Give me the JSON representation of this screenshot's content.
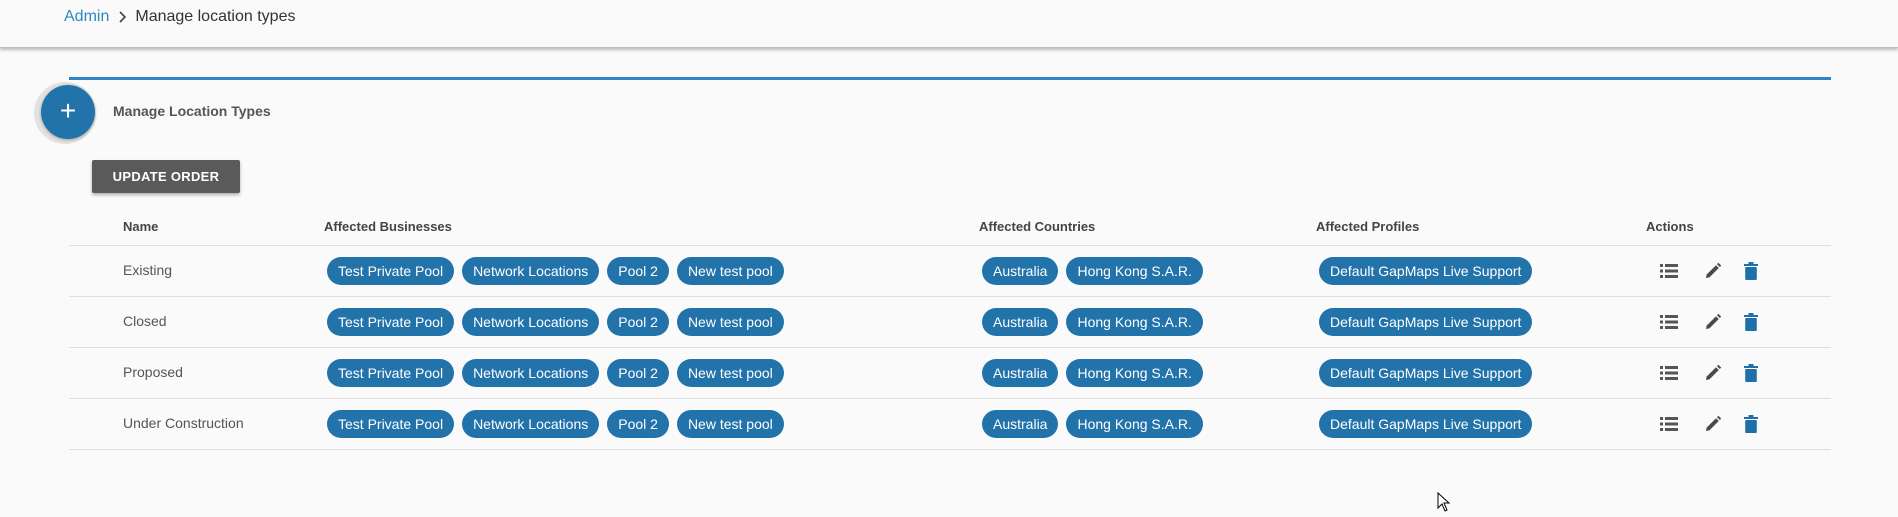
{
  "breadcrumb": {
    "root": "Admin",
    "current": "Manage location types"
  },
  "add_button": "+",
  "section_title": "Manage Location Types",
  "update_order_label": "UPDATE ORDER",
  "columns": {
    "name": "Name",
    "businesses": "Affected Businesses",
    "countries": "Affected Countries",
    "profiles": "Affected Profiles",
    "actions": "Actions"
  },
  "rows": [
    {
      "name": "Existing",
      "businesses": [
        "Test Private Pool",
        "Network Locations",
        "Pool 2",
        "New test pool"
      ],
      "countries": [
        "Australia",
        "Hong Kong S.A.R."
      ],
      "profiles": [
        "Default GapMaps Live Support"
      ]
    },
    {
      "name": "Closed",
      "businesses": [
        "Test Private Pool",
        "Network Locations",
        "Pool 2",
        "New test pool"
      ],
      "countries": [
        "Australia",
        "Hong Kong S.A.R."
      ],
      "profiles": [
        "Default GapMaps Live Support"
      ]
    },
    {
      "name": "Proposed",
      "businesses": [
        "Test Private Pool",
        "Network Locations",
        "Pool 2",
        "New test pool"
      ],
      "countries": [
        "Australia",
        "Hong Kong S.A.R."
      ],
      "profiles": [
        "Default GapMaps Live Support"
      ]
    },
    {
      "name": "Under Construction",
      "businesses": [
        "Test Private Pool",
        "Network Locations",
        "Pool 2",
        "New test pool"
      ],
      "countries": [
        "Australia",
        "Hong Kong S.A.R."
      ],
      "profiles": [
        "Default GapMaps Live Support"
      ]
    }
  ],
  "icons": {
    "list": "list-icon",
    "edit": "pencil-icon",
    "delete": "trash-icon"
  },
  "colors": {
    "accent": "#2f86c7",
    "chip": "#2373ab",
    "button_dark": "#5a5a5a"
  }
}
